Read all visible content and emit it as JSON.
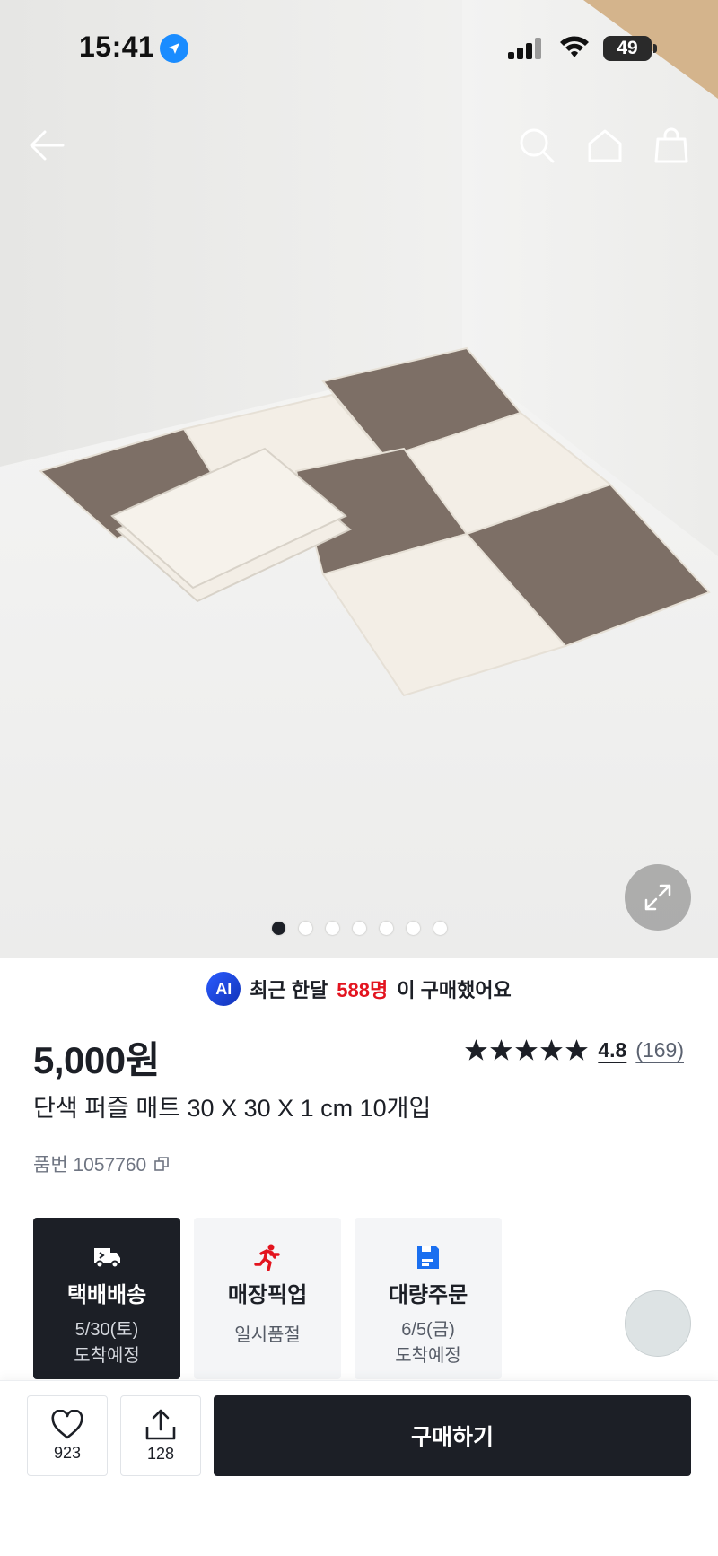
{
  "status_bar": {
    "time": "15:41",
    "battery": "49"
  },
  "nav": {
    "back_icon": "arrow-left-icon",
    "search_icon": "search-icon",
    "home_icon": "home-icon",
    "cart_icon": "shopping-bag-icon"
  },
  "gallery": {
    "image_count": 7,
    "active_index": 0
  },
  "recent": {
    "badge": "AI",
    "prefix": "최근 한달",
    "count": "588명",
    "suffix": "이 구매했어요"
  },
  "product": {
    "price": "5,000원",
    "rating": "4.8",
    "review_count": "(169)",
    "rating_fraction": 0.96,
    "title": "단색 퍼즐 매트 30 X 30 X 1 cm 10개입",
    "sku": "품번 1057760"
  },
  "delivery_options": [
    {
      "title": "택배배송",
      "line1": "5/30(토)",
      "line2": "도착예정",
      "selected": true
    },
    {
      "title": "매장픽업",
      "line1": "일시품절",
      "line2": "",
      "selected": false
    },
    {
      "title": "대량주문",
      "line1": "6/5(금)",
      "line2": "도착예정",
      "selected": false
    }
  ],
  "bottom_bar": {
    "like_count": "923",
    "share_count": "128",
    "buy_label": "구매하기"
  },
  "colors": {
    "brand_dark": "#1c1f26",
    "accent_red": "#e3141f",
    "ai_blue": "#2b5cff",
    "mat_brown": "#7d6f66",
    "mat_cream": "#f3eee6"
  }
}
